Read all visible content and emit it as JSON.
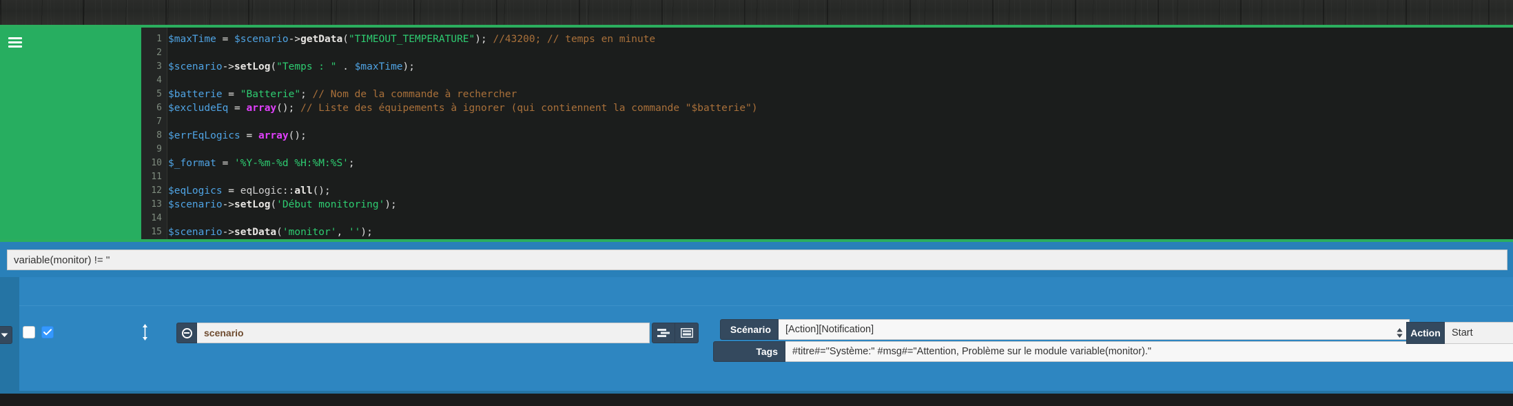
{
  "theme": {
    "accent_green": "#27ae60",
    "accent_blue": "#2980b9",
    "panel_dark": "#34495e",
    "editor_bg": "#1b1d1c",
    "checkbox_blue": "#3498ff"
  },
  "sidebar": {
    "menu_icon": "hamburger-icon"
  },
  "editor": {
    "language": "php",
    "gutter_numbers": [
      "1",
      "2",
      "3",
      "4",
      "5",
      "6",
      "7",
      "8",
      "9",
      "10",
      "11",
      "12",
      "13",
      "14",
      "15"
    ],
    "lines": [
      {
        "number": "1",
        "tokens": [
          {
            "t": "$maxTime",
            "c": "var"
          },
          {
            "t": " = ",
            "c": "op"
          },
          {
            "t": "$scenario",
            "c": "var"
          },
          {
            "t": "->",
            "c": "op"
          },
          {
            "t": "getData",
            "c": "fn"
          },
          {
            "t": "(",
            "c": "plain"
          },
          {
            "t": "\"TIMEOUT_TEMPERATURE\"",
            "c": "str"
          },
          {
            "t": ");",
            "c": "plain"
          },
          {
            "t": " //43200; // temps en minute",
            "c": "com"
          }
        ]
      },
      {
        "number": "2",
        "tokens": []
      },
      {
        "number": "3",
        "tokens": [
          {
            "t": "$scenario",
            "c": "var"
          },
          {
            "t": "->",
            "c": "op"
          },
          {
            "t": "setLog",
            "c": "fn"
          },
          {
            "t": "(",
            "c": "plain"
          },
          {
            "t": "\"Temps : \"",
            "c": "str"
          },
          {
            "t": " . ",
            "c": "plain"
          },
          {
            "t": "$maxTime",
            "c": "var"
          },
          {
            "t": ");",
            "c": "plain"
          }
        ]
      },
      {
        "number": "4",
        "tokens": []
      },
      {
        "number": "5",
        "tokens": [
          {
            "t": "$batterie",
            "c": "var"
          },
          {
            "t": " = ",
            "c": "op"
          },
          {
            "t": "\"Batterie\"",
            "c": "str"
          },
          {
            "t": ";",
            "c": "plain"
          },
          {
            "t": " // Nom de la commande à rechercher",
            "c": "com"
          }
        ]
      },
      {
        "number": "6",
        "tokens": [
          {
            "t": "$excludeEq",
            "c": "var"
          },
          {
            "t": " = ",
            "c": "op"
          },
          {
            "t": "array",
            "c": "kw"
          },
          {
            "t": "();",
            "c": "plain"
          },
          {
            "t": " // Liste des équipements à ignorer (qui contiennent la commande \"$batterie\")",
            "c": "com"
          }
        ]
      },
      {
        "number": "7",
        "tokens": []
      },
      {
        "number": "8",
        "tokens": [
          {
            "t": "$errEqLogics",
            "c": "var"
          },
          {
            "t": " = ",
            "c": "op"
          },
          {
            "t": "array",
            "c": "kw"
          },
          {
            "t": "();",
            "c": "plain"
          }
        ]
      },
      {
        "number": "9",
        "tokens": []
      },
      {
        "number": "10",
        "tokens": [
          {
            "t": "$_format",
            "c": "var"
          },
          {
            "t": " = ",
            "c": "op"
          },
          {
            "t": "'%Y-%m-%d %H:%M:%S'",
            "c": "str"
          },
          {
            "t": ";",
            "c": "plain"
          }
        ]
      },
      {
        "number": "11",
        "tokens": []
      },
      {
        "number": "12",
        "tokens": [
          {
            "t": "$eqLogics",
            "c": "var"
          },
          {
            "t": " = ",
            "c": "op"
          },
          {
            "t": "eqLogic",
            "c": "cls"
          },
          {
            "t": "::",
            "c": "plain"
          },
          {
            "t": "all",
            "c": "fn"
          },
          {
            "t": "();",
            "c": "plain"
          }
        ]
      },
      {
        "number": "13",
        "tokens": [
          {
            "t": "$scenario",
            "c": "var"
          },
          {
            "t": "->",
            "c": "op"
          },
          {
            "t": "setLog",
            "c": "fn"
          },
          {
            "t": "(",
            "c": "plain"
          },
          {
            "t": "'Début monitoring'",
            "c": "str"
          },
          {
            "t": ");",
            "c": "plain"
          }
        ]
      },
      {
        "number": "14",
        "tokens": []
      },
      {
        "number": "15",
        "tokens": [
          {
            "t": "$scenario",
            "c": "var"
          },
          {
            "t": "->",
            "c": "op"
          },
          {
            "t": "setData",
            "c": "fn"
          },
          {
            "t": "(",
            "c": "plain"
          },
          {
            "t": "'monitor'",
            "c": "str"
          },
          {
            "t": ", ",
            "c": "plain"
          },
          {
            "t": "''",
            "c": "str"
          },
          {
            "t": ");",
            "c": "plain"
          }
        ]
      }
    ]
  },
  "condition": {
    "value": "variable(monitor) != ''",
    "placeholder": "Condition"
  },
  "action_block": {
    "collapse_icon": "chevron-down-icon",
    "drag_handle_icon": "vertical-resize-icon",
    "remove_icon": "minus-circle-icon",
    "checkbox_blank_checked": false,
    "checkbox_enabled_checked": true,
    "command_value": "scenario",
    "command_placeholder": "Commande",
    "icon_button_1": "sliders-list-icon",
    "icon_button_2": "window-form-icon",
    "fields": [
      {
        "label": "Scénario",
        "value": "[Action][Notification]",
        "placeholder": "Scénario"
      },
      {
        "label": "Tags",
        "value": "#titre#=\"Système:\" #msg#=\"Attention, Problème sur le module variable(monitor).\"",
        "placeholder": "Tags"
      }
    ],
    "spinner_icon": "updown-spinner-icon",
    "action_button_label": "Action",
    "action_mode_value": "Start",
    "action_mode_placeholder": "Start"
  }
}
